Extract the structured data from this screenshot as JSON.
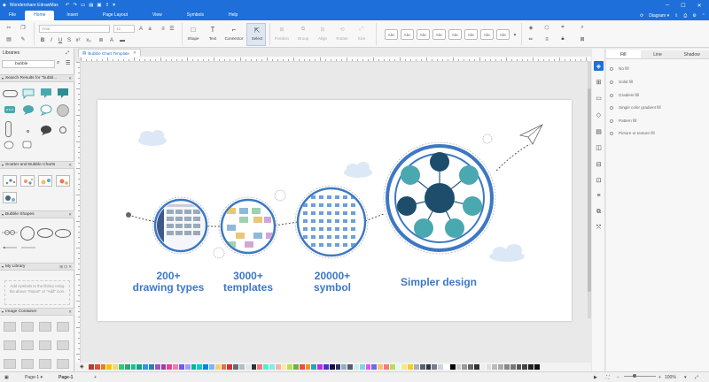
{
  "app": {
    "title": "Wondershare EdrawMax",
    "diagram_btn": "Diagram",
    "undo_icon": "undo-icon",
    "redo_icon": "redo-icon"
  },
  "menu": {
    "items": [
      "File",
      "Home",
      "Insert",
      "Page Layout",
      "View",
      "Symbols",
      "Help"
    ],
    "active": "Home"
  },
  "ribbon": {
    "font_placeholder": "Arial",
    "size_placeholder": "12",
    "tools": [
      "Shape",
      "Text",
      "Connector",
      "Select"
    ],
    "disabled_tools": [
      "Position",
      "Group",
      "Align",
      "Rotate",
      "Size"
    ],
    "style_label": "Abc"
  },
  "library": {
    "title": "Libraries",
    "search_value": "bubble",
    "sections": [
      {
        "name": "Search Results for \"bubbl..."
      },
      {
        "name": "Scatter and Bubble Charts"
      },
      {
        "name": "Bubble Shapes"
      },
      {
        "name": "My Library"
      },
      {
        "name": "Image Container"
      }
    ],
    "my_library_hint": "Add symbols to the library using the above \"Import\" or \"Add\" icon."
  },
  "document": {
    "tab": "Bubble Chart Template"
  },
  "canvas": {
    "labels": [
      {
        "lines": [
          "200+",
          "drawing types"
        ]
      },
      {
        "lines": [
          "3000+",
          "templates"
        ]
      },
      {
        "lines": [
          "20000+",
          "symbol"
        ]
      },
      {
        "lines": [
          "Simpler design"
        ]
      }
    ]
  },
  "right_panel": {
    "tabs": [
      "Fill",
      "Line",
      "Shadow"
    ],
    "active_tab": "Fill",
    "fill_options": [
      "No fill",
      "Solid fill",
      "Gradient fill",
      "Single color gradient fill",
      "Pattern fill",
      "Picture or texture fill"
    ]
  },
  "status": {
    "page_selector": "Page-1",
    "page_tab": "Page-1",
    "zoom": "100%"
  },
  "colors": {
    "accent": "#1e6fd9",
    "bubble_blue": "#3d78c4",
    "teal": "#4aa8b0",
    "navy": "#1e4d6b"
  }
}
